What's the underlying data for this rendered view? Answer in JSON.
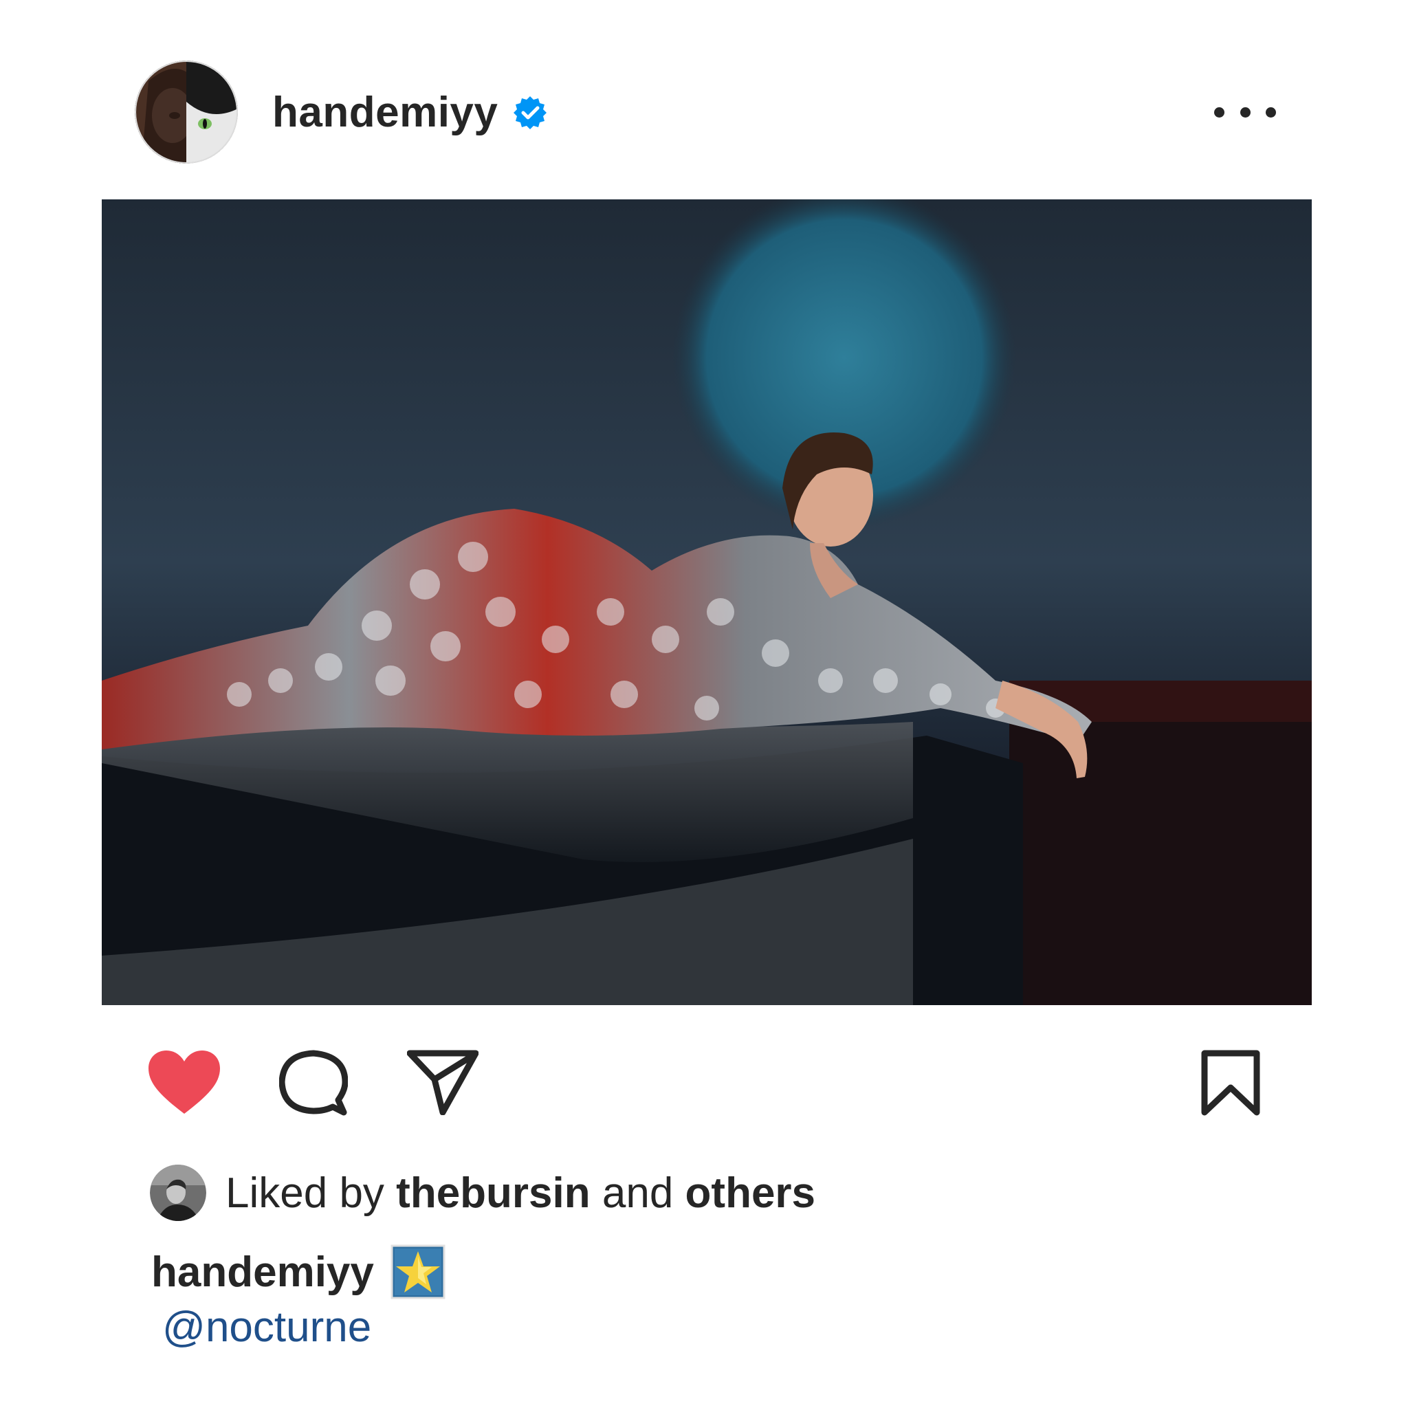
{
  "post": {
    "username": "handemiyy",
    "verified": true,
    "more_icon": "more-horizontal-icon"
  },
  "actions": {
    "like_icon": "heart-filled-icon",
    "like_color": "#ed4956",
    "comment_icon": "comment-icon",
    "share_icon": "paper-plane-icon",
    "save_icon": "bookmark-icon"
  },
  "likes": {
    "prefix": "Liked by",
    "user": "thebursin",
    "conjunction": "and",
    "others": "others"
  },
  "caption": {
    "username": "handemiyy",
    "emoji": "glowing-star",
    "mention": "@nocturne"
  },
  "colors": {
    "text": "#262626",
    "verified_blue": "#0095f6",
    "mention_blue": "#1f4f8a"
  }
}
